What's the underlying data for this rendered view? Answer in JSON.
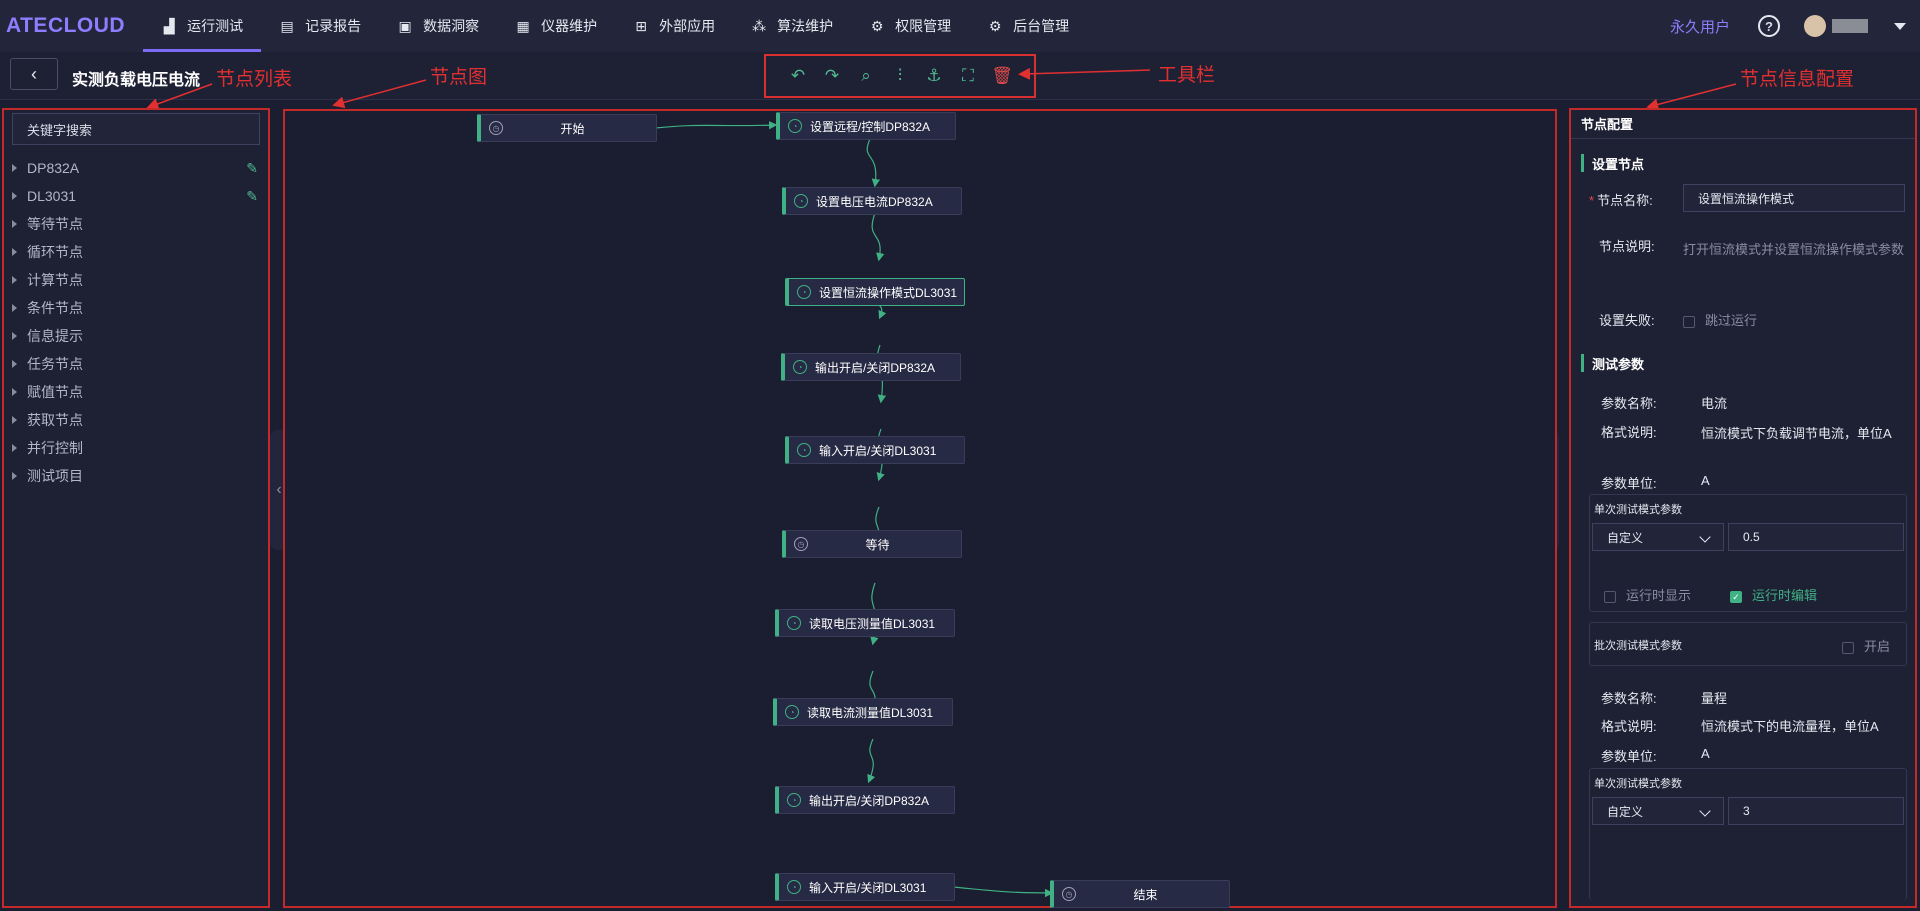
{
  "app": {
    "logo": "ATECLOUD"
  },
  "nav": {
    "items": [
      {
        "label": "运行测试",
        "icon": "chart-icon",
        "active": true
      },
      {
        "label": "记录报告",
        "icon": "clipboard-icon"
      },
      {
        "label": "数据洞察",
        "icon": "monitor-icon"
      },
      {
        "label": "仪器维护",
        "icon": "instrument-icon"
      },
      {
        "label": "外部应用",
        "icon": "grid-icon"
      },
      {
        "label": "算法维护",
        "icon": "nodes-icon"
      },
      {
        "label": "权限管理",
        "icon": "gear-icon"
      },
      {
        "label": "后台管理",
        "icon": "settings-icon"
      }
    ],
    "user_type": "永久用户"
  },
  "subheader": {
    "page_title": "实测负载电压电流"
  },
  "annotations": {
    "node_list": "节点列表",
    "node_graph": "节点图",
    "toolbar": "工具栏",
    "node_config": "节点信息配置"
  },
  "left_panel": {
    "search_placeholder": "关键字搜索",
    "tree": [
      {
        "label": "DP832A",
        "editable": true
      },
      {
        "label": "DL3031",
        "editable": true
      },
      {
        "label": "等待节点"
      },
      {
        "label": "循环节点"
      },
      {
        "label": "计算节点"
      },
      {
        "label": "条件节点"
      },
      {
        "label": "信息提示"
      },
      {
        "label": "任务节点"
      },
      {
        "label": "赋值节点"
      },
      {
        "label": "获取节点"
      },
      {
        "label": "并行控制"
      },
      {
        "label": "测试项目"
      }
    ]
  },
  "graph": {
    "nodes": [
      {
        "label": "开始",
        "type": "clock"
      },
      {
        "label": "设置远程/控制DP832A",
        "type": "gauge"
      },
      {
        "label": "设置电压电流DP832A",
        "type": "gauge"
      },
      {
        "label": "设置恒流操作模式DL3031",
        "type": "gauge",
        "selected": true
      },
      {
        "label": "输出开启/关闭DP832A",
        "type": "gauge"
      },
      {
        "label": "输入开启/关闭DL3031",
        "type": "gauge"
      },
      {
        "label": "等待",
        "type": "clock"
      },
      {
        "label": "读取电压测量值DL3031",
        "type": "gauge"
      },
      {
        "label": "读取电流测量值DL3031",
        "type": "gauge"
      },
      {
        "label": "输出开启/关闭DP832A",
        "type": "gauge"
      },
      {
        "label": "输入开启/关闭DL3031",
        "type": "gauge"
      },
      {
        "label": "结束",
        "type": "clock"
      }
    ],
    "link_color": "#3fb184"
  },
  "config": {
    "title": "节点配置",
    "set_node_section": "设置节点",
    "node_name_label": "节点名称:",
    "node_name_value": "设置恒流操作模式",
    "node_desc_label": "节点说明:",
    "node_desc_value": "打开恒流模式并设置恒流操作模式参数",
    "fail_label": "设置失败:",
    "fail_option": "跳过运行",
    "test_params_section": "测试参数",
    "params": [
      {
        "name_label": "参数名称:",
        "name": "电流",
        "format_label": "格式说明:",
        "format": "恒流模式下负载调节电流，单位A",
        "unit_label": "参数单位:",
        "unit": "A",
        "single_title": "单次测试模式参数",
        "mode": "自定义",
        "value": "0.5",
        "show_at_runtime": "运行时显示",
        "edit_at_runtime": "运行时编辑",
        "batch_title": "批次测试模式参数",
        "batch_enable": "开启"
      },
      {
        "name_label": "参数名称:",
        "name": "量程",
        "format_label": "格式说明:",
        "format": "恒流模式下的电流量程，单位A",
        "unit_label": "参数单位:",
        "unit": "A",
        "single_title": "单次测试模式参数",
        "mode": "自定义",
        "value": "3"
      }
    ]
  }
}
